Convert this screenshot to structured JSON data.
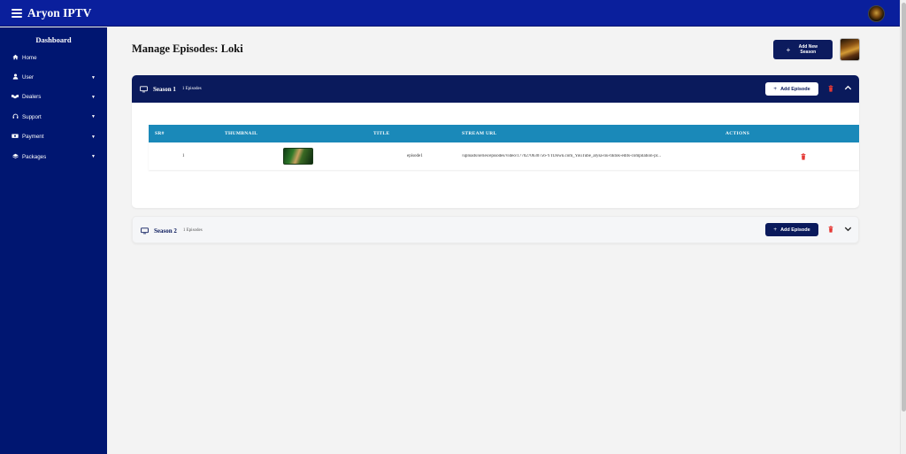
{
  "app": {
    "title": "Aryon IPTV"
  },
  "sidebar": {
    "title": "Dashboard",
    "items": [
      {
        "label": "Home",
        "icon": "home-icon",
        "has_submenu": false
      },
      {
        "label": "User",
        "icon": "user-icon",
        "has_submenu": true
      },
      {
        "label": "Dealers",
        "icon": "handshake-icon",
        "has_submenu": true
      },
      {
        "label": "Support",
        "icon": "headset-icon",
        "has_submenu": true
      },
      {
        "label": "Payment",
        "icon": "money-icon",
        "has_submenu": true
      },
      {
        "label": "Packages",
        "icon": "layers-icon",
        "has_submenu": true
      }
    ]
  },
  "main": {
    "title": "Manage Episodes: Loki",
    "add_season_label": "Add New Season",
    "seasons": [
      {
        "name": "Season 1",
        "count_label": "1 Episodes",
        "expanded": true,
        "add_episode_label": "Add Episode",
        "table": {
          "headers": [
            "SR#",
            "THUMBNAIL",
            "TITLE",
            "STREAM URL",
            "ACTIONS"
          ],
          "rows": [
            {
              "sr": "1",
              "title": "episode1",
              "stream_url": "/uploads/series/episodes/video/1770270630756-YTDown.com_YouTube_alysa-liu-tiktok-edits-compilation-pr..."
            }
          ]
        }
      },
      {
        "name": "Season 2",
        "count_label": "1 Episodes",
        "expanded": false,
        "add_episode_label": "Add Episode"
      }
    ]
  },
  "colors": {
    "topbar": "#0a1f9c",
    "sidebar": "#001671",
    "primary_button": "#0a1a5c",
    "table_header": "#1a89b9",
    "danger": "#e53935"
  }
}
